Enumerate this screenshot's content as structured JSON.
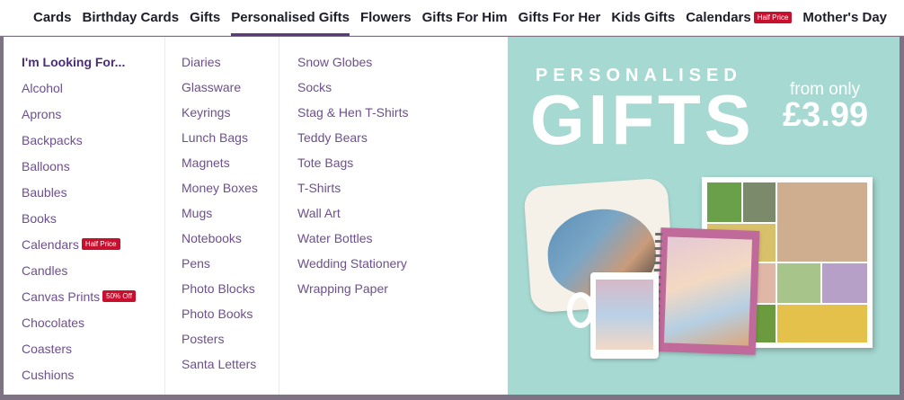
{
  "nav": {
    "items": [
      {
        "label": "Cards"
      },
      {
        "label": "Birthday Cards"
      },
      {
        "label": "Gifts"
      },
      {
        "label": "Personalised Gifts",
        "active": true
      },
      {
        "label": "Flowers"
      },
      {
        "label": "Gifts For Him"
      },
      {
        "label": "Gifts For Her"
      },
      {
        "label": "Kids Gifts"
      },
      {
        "label": "Calendars",
        "badge": "Half Price"
      },
      {
        "label": "Mother's Day"
      }
    ]
  },
  "menu": {
    "heading": "I'm Looking For...",
    "col1": [
      {
        "label": "Alcohol"
      },
      {
        "label": "Aprons"
      },
      {
        "label": "Backpacks"
      },
      {
        "label": "Balloons"
      },
      {
        "label": "Baubles"
      },
      {
        "label": "Books"
      },
      {
        "label": "Calendars",
        "badge": "Half Price"
      },
      {
        "label": "Candles"
      },
      {
        "label": "Canvas Prints",
        "badge": "50% Off"
      },
      {
        "label": "Chocolates"
      },
      {
        "label": "Coasters"
      },
      {
        "label": "Cushions"
      }
    ],
    "col2": [
      {
        "label": "Diaries"
      },
      {
        "label": "Glassware"
      },
      {
        "label": "Keyrings"
      },
      {
        "label": "Lunch Bags"
      },
      {
        "label": "Magnets"
      },
      {
        "label": "Money Boxes"
      },
      {
        "label": "Mugs"
      },
      {
        "label": "Notebooks"
      },
      {
        "label": "Pens"
      },
      {
        "label": "Photo Blocks"
      },
      {
        "label": "Photo Books"
      },
      {
        "label": "Posters"
      },
      {
        "label": "Santa Letters"
      }
    ],
    "col3": [
      {
        "label": "Snow Globes"
      },
      {
        "label": "Socks"
      },
      {
        "label": "Stag & Hen T-Shirts"
      },
      {
        "label": "Teddy Bears"
      },
      {
        "label": "Tote Bags"
      },
      {
        "label": "T-Shirts"
      },
      {
        "label": "Wall Art"
      },
      {
        "label": "Water Bottles"
      },
      {
        "label": "Wedding Stationery"
      },
      {
        "label": "Wrapping Paper"
      }
    ]
  },
  "banner": {
    "small_title": "PERSONALISED",
    "big_title": "GIFTS",
    "from_only": "from only",
    "price": "£3.99",
    "background": "#a6d9d2"
  },
  "colors": {
    "link": "#6d4f8f",
    "heading": "#4a2d7a",
    "badge": "#c8102e",
    "active_underline": "#5a3a7a"
  }
}
